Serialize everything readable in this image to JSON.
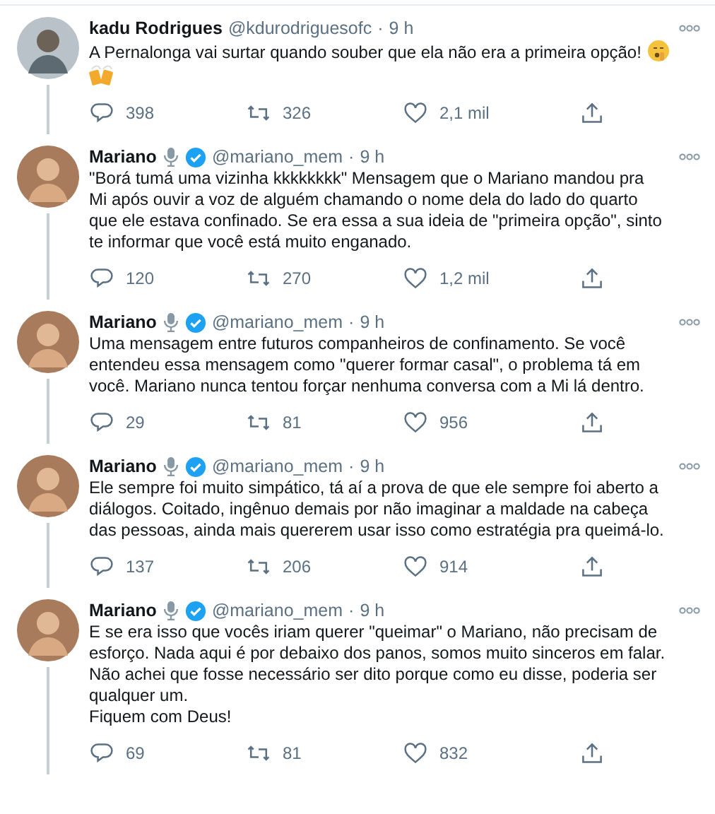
{
  "tweets": [
    {
      "name": "kadu Rodrigues",
      "handle": "@kdurodriguesofc",
      "separator": "·",
      "time": "9 h",
      "microphone_badge": false,
      "verified": false,
      "text": "A Pernalonga vai surtar quando souber que ela não era a primeira opção!",
      "ends_with_emojis": true,
      "replies": "398",
      "retweets": "326",
      "likes": "2,1 mil"
    },
    {
      "name": "Mariano",
      "handle": "@mariano_mem",
      "time": "9 h",
      "separator": "·",
      "microphone_badge": true,
      "verified": true,
      "text": "\"Borá tumá uma vizinha kkkkkkkk\" Mensagem que o Mariano mandou pra\nMi após ouvir a voz de alguém chamando o nome dela do lado do quarto\nque ele estava confinado. Se era essa a sua ideia de \"primeira opção\", sinto\nte informar que você está muito enganado.",
      "ends_with_emojis": false,
      "replies": "120",
      "retweets": "270",
      "likes": "1,2 mil"
    },
    {
      "name": "Mariano",
      "handle": "@mariano_mem",
      "time": "9 h",
      "separator": "·",
      "microphone_badge": true,
      "verified": true,
      "text": "Uma mensagem entre futuros companheiros de confinamento. Se você\nentendeu essa mensagem como \"querer formar casal\", o problema tá em\nvocê. Mariano nunca tentou forçar nenhuma conversa com a Mi lá dentro.",
      "ends_with_emojis": false,
      "replies": "29",
      "retweets": "81",
      "likes": "956"
    },
    {
      "name": "Mariano",
      "handle": "@mariano_mem",
      "time": "9 h",
      "separator": "·",
      "microphone_badge": true,
      "verified": true,
      "text": "Ele sempre foi muito simpático, tá aí a prova de que ele sempre foi aberto a\ndiálogos. Coitado, ingênuo demais por não imaginar a maldade na cabeça\ndas pessoas, ainda mais quererem usar isso como estratégia pra queimá-lo.",
      "ends_with_emojis": false,
      "replies": "137",
      "retweets": "206",
      "likes": "914"
    },
    {
      "name": "Mariano",
      "handle": "@mariano_mem",
      "time": "9 h",
      "separator": "·",
      "microphone_badge": true,
      "verified": true,
      "text": "E se era isso que vocês iriam querer \"queimar\" o Mariano, não precisam de\nesforço. Nada aqui é por debaixo dos panos, somos muito sinceros em falar.\nNão achei que fosse necessário ser dito porque como eu disse, poderia ser\nqualquer um.\nFiquem com Deus!",
      "ends_with_emojis": false,
      "replies": "69",
      "retweets": "81",
      "likes": "832"
    }
  ]
}
